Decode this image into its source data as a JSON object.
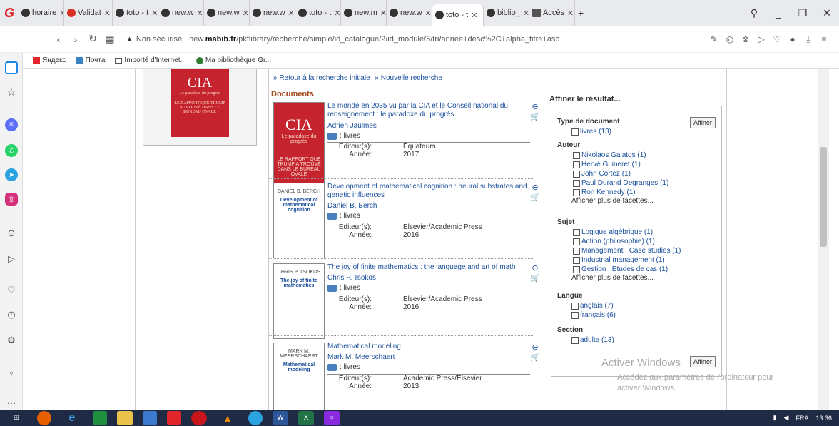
{
  "tabs": [
    {
      "label": "horaire"
    },
    {
      "label": "Validat"
    },
    {
      "label": "toto - t"
    },
    {
      "label": "new.w"
    },
    {
      "label": "new.w"
    },
    {
      "label": "new.w"
    },
    {
      "label": "toto - t"
    },
    {
      "label": "new.m"
    },
    {
      "label": "new.w"
    },
    {
      "label": "toto - t"
    },
    {
      "label": "biblio_"
    },
    {
      "label": "Accès"
    }
  ],
  "address": {
    "warning": "Non sécurisé",
    "url_prefix": "new.",
    "url_domain": "mabib.fr",
    "url_rest": "/pkflibrary/recherche/simple/id_catalogue/2/id_module/5/tri/annee+desc%2C+alpha_titre+asc"
  },
  "bookmarks": [
    "Яндекс",
    "Почта",
    "Importé d'Internet...",
    "Ma bibliothèque Gr..."
  ],
  "breadcrumb": {
    "back": "» Retour à la recherche initiale",
    "new": "» Nouvelle recherche"
  },
  "documents_title": "Documents",
  "labels": {
    "type": ": livres",
    "publisher": "Editeur(s):",
    "year": "Année:"
  },
  "records": [
    {
      "title": "Le monde en 2035 vu par la CIA et le Conseil national du renseignement : le paradoxe du progrès",
      "author": "Adrien Jaulmes",
      "publisher": "Équateurs",
      "year": "2017",
      "cover_line1": "CIA",
      "cover_line2": "Le paradoxe du progrès",
      "cover_line3": "LE RAPPORT QUE TRUMP A TROUVÉ DANS LE BUREAU OVALE"
    },
    {
      "title": "Development of mathematical cognition : neural substrates and genetic influences",
      "author": "Daniel B. Berch",
      "publisher": "Elsevier/Academic Press",
      "year": "2016",
      "cover_author": "DANIEL B. BERCH",
      "cover_title": "Development of mathematical cognition"
    },
    {
      "title": "The joy of finite mathematics : the language and art of math",
      "author": "Chris P. Tsokos",
      "publisher": "Elsevier/Academic Press",
      "year": "2016",
      "cover_author": "CHRIS P. TSOKOS",
      "cover_title": "The joy of finite mathematics"
    },
    {
      "title": "Mathematical modeling",
      "author": "Mark M. Meerschaert",
      "publisher": "Academic Press/Elsevier",
      "year": "2013",
      "cover_author": "MARK M. MEERSCHAERT",
      "cover_title": "Mathematical modeling"
    }
  ],
  "refine": {
    "title": "Affiner le résultat...",
    "button": "Affiner"
  },
  "facets": {
    "type": {
      "heading": "Type de document",
      "items": [
        "livres (13)"
      ]
    },
    "author": {
      "heading": "Auteur",
      "items": [
        "Nikolaos Galatos (1)",
        "Hervé Guineret (1)",
        "John Cortez (1)",
        "Paul Durand Degranges (1)",
        "Ron Kennedy (1)"
      ],
      "more": "Afficher plus de facettes..."
    },
    "subject": {
      "heading": "Sujet",
      "items": [
        "Logique algébrique (1)",
        "Action (philosophie) (1)",
        "Management : Case studies (1)",
        "Industrial management (1)",
        "Gestion : Études de cas (1)"
      ],
      "more": "Afficher plus de facettes..."
    },
    "lang": {
      "heading": "Langue",
      "items": [
        "anglais (7)",
        "français (6)"
      ]
    },
    "section": {
      "heading": "Section",
      "items": [
        "adulte (13)"
      ]
    }
  },
  "watermark": {
    "line1": "Activer Windows",
    "line2": "Accédez aux paramètres de l'ordinateur pour",
    "line3": "activer Windows."
  },
  "tray": {
    "lang": "FRA",
    "time": "13:36"
  }
}
